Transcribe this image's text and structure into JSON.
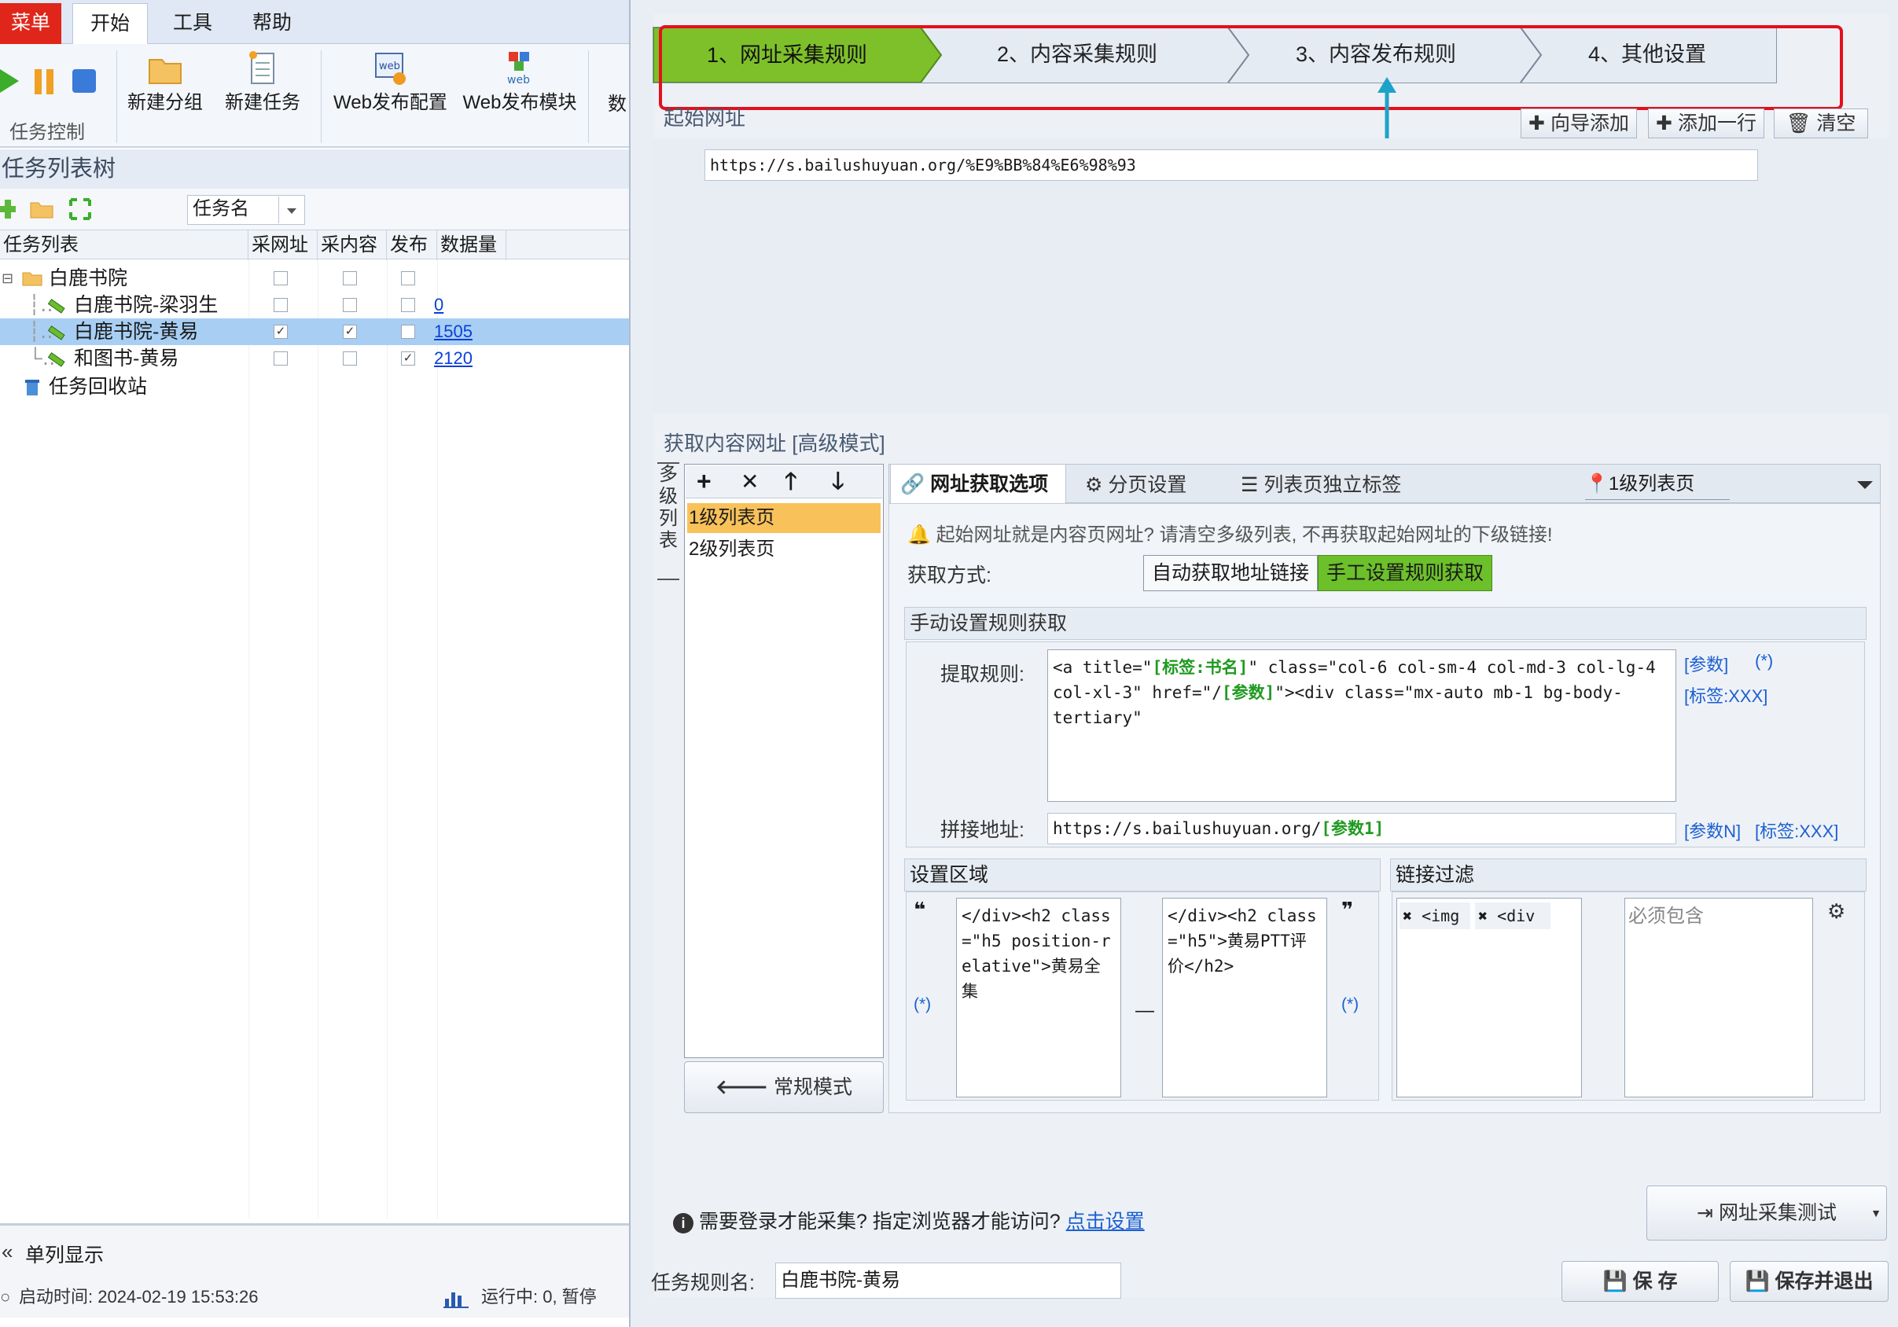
{
  "menubar": {
    "tabs": [
      "菜单",
      "开始",
      "工具",
      "帮助"
    ]
  },
  "ribbon": {
    "group_label": "任务控制",
    "buttons": [
      "新建分组",
      "新建任务",
      "Web发布配置",
      "Web发布模块",
      "数"
    ]
  },
  "tree": {
    "title": "任务列表树",
    "filter_value": "任务名",
    "columns": [
      "任务列表",
      "采网址",
      "采内容",
      "发布",
      "数据量"
    ],
    "rows": [
      {
        "label": "白鹿书院",
        "type": "folder",
        "counts": ""
      },
      {
        "label": "白鹿书院-梁羽生",
        "type": "task",
        "count": "0"
      },
      {
        "label": "白鹿书院-黄易",
        "type": "task",
        "count": "1505"
      },
      {
        "label": "和图书-黄易",
        "type": "task",
        "count": "2120"
      },
      {
        "label": "任务回收站",
        "type": "recycle",
        "count": ""
      }
    ],
    "single_column": "单列显示",
    "start_time": "启动时间: 2024-02-19 15:53:26",
    "running": "运行中: 0, 暂停"
  },
  "dialog": {
    "steps": [
      "1、网址采集规则",
      "2、内容采集规则",
      "3、内容发布规则",
      "4、其他设置"
    ],
    "start_url_group": "起始网址",
    "start_url_buttons": [
      "向导添加",
      "添加一行",
      "清空"
    ],
    "start_url": "https://s.bailushuyuan.org/%E9%BB%84%E6%98%93",
    "content_url_group": "获取内容网址 [高级模式]",
    "multi_list_label": "多级列表",
    "list_levels": [
      "1级列表页",
      "2级列表页"
    ],
    "normal_mode": "常规模式",
    "tabs": [
      "网址获取选项",
      "分页设置",
      "列表页独立标签"
    ],
    "level_select": "1级列表页",
    "notice": "起始网址就是内容页网址? 请清空多级列表, 不再获取起始网址的下级链接!",
    "fetch_method_label": "获取方式:",
    "fetch_methods": [
      "自动获取地址链接",
      "手工设置规则获取"
    ],
    "manual_group": "手动设置规则获取",
    "extract_label": "提取规则:",
    "extract_rule_parts": [
      "<a title=\"",
      "[标签:书名]",
      "\" class=\"col-6 col-sm-4 col-md-3 col-lg-4 col-xl-3\" href=\"/",
      "[参数]",
      "\"><div class=\"mx-auto mb-1 bg-body-tertiary\""
    ],
    "extract_links": [
      "[参数]",
      "(*)",
      "[标签:XXX]"
    ],
    "join_label": "拼接地址:",
    "join_prefix": "https://s.bailushuyuan.org/",
    "join_param": "[参数1]",
    "join_links": [
      "[参数N]",
      "[标签:XXX]"
    ],
    "area_group": "设置区域",
    "area_start": "</div><h2 class=\"h5 position-relative\">黄易全集",
    "area_end": "</div><h2 class=\"h5\">黄易PTT评价</h2>",
    "area_wild": "(*)",
    "filter_group": "链接过滤",
    "filter_tags": [
      "<img",
      "<div"
    ],
    "must_contain": "必须包含",
    "login_notice": "需要登录才能采集? 指定浏览器才能访问?",
    "login_link": "点击设置",
    "test_button": "网址采集测试",
    "rule_name_label": "任务规则名:",
    "rule_name": "白鹿书院-黄易",
    "save": "保 存",
    "save_exit": "保存并退出"
  },
  "colors": {
    "active_step": "#7ec02a",
    "highlight_red": "#e3101c",
    "arrow": "#1ea3c8",
    "selected_row": "#a8cff3"
  }
}
